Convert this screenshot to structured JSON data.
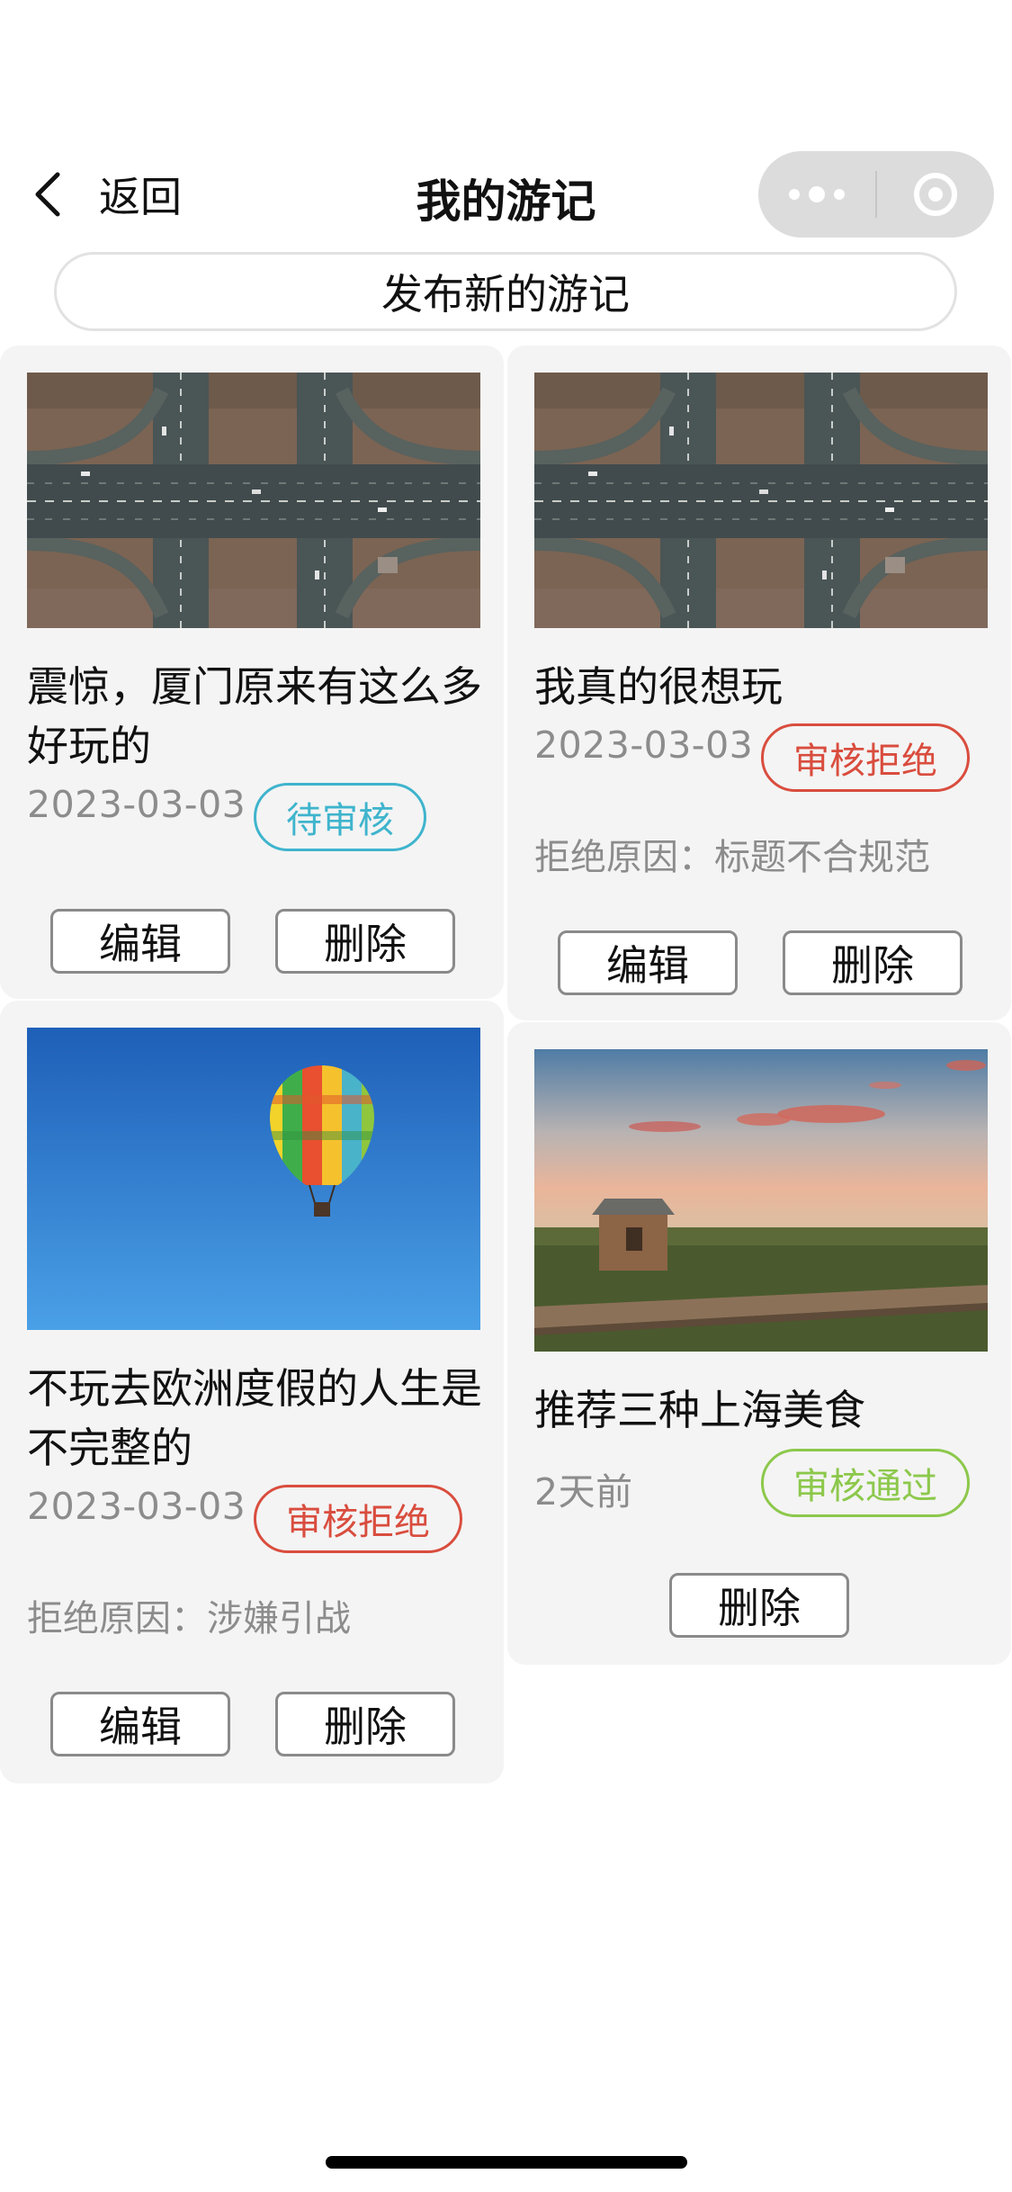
{
  "navbar": {
    "back_label": "返回",
    "title": "我的游记",
    "back_icon": "chevron-left-icon",
    "more_icon": "more-dots-icon",
    "close_icon": "target-circle-icon"
  },
  "publish_button": "发布新的游记",
  "cards": [
    {
      "title": "震惊，厦门原来有这么多好玩的",
      "date": "2023-03-03",
      "status": "待审核",
      "status_color": "#3fb4cd",
      "image": "highway-aerial",
      "edit": "编辑",
      "delete": "删除"
    },
    {
      "title": "我真的很想玩",
      "date": "2023-03-03",
      "status": "审核拒绝",
      "status_color": "#d94d3e",
      "reason": "拒绝原因：标题不合规范",
      "image": "highway-aerial",
      "edit": "编辑",
      "delete": "删除"
    },
    {
      "title": "不玩去欧洲度假的人生是不完整的",
      "date": "2023-03-03",
      "status": "审核拒绝",
      "status_color": "#d94d3e",
      "reason": "拒绝原因：涉嫌引战",
      "image": "hot-air-balloon",
      "edit": "编辑",
      "delete": "删除"
    },
    {
      "title": "推荐三种上海美食",
      "date": "2天前",
      "status": "审核通过",
      "status_color": "#8cc84b",
      "image": "prairie-cabin-sunset",
      "delete": "删除"
    }
  ]
}
